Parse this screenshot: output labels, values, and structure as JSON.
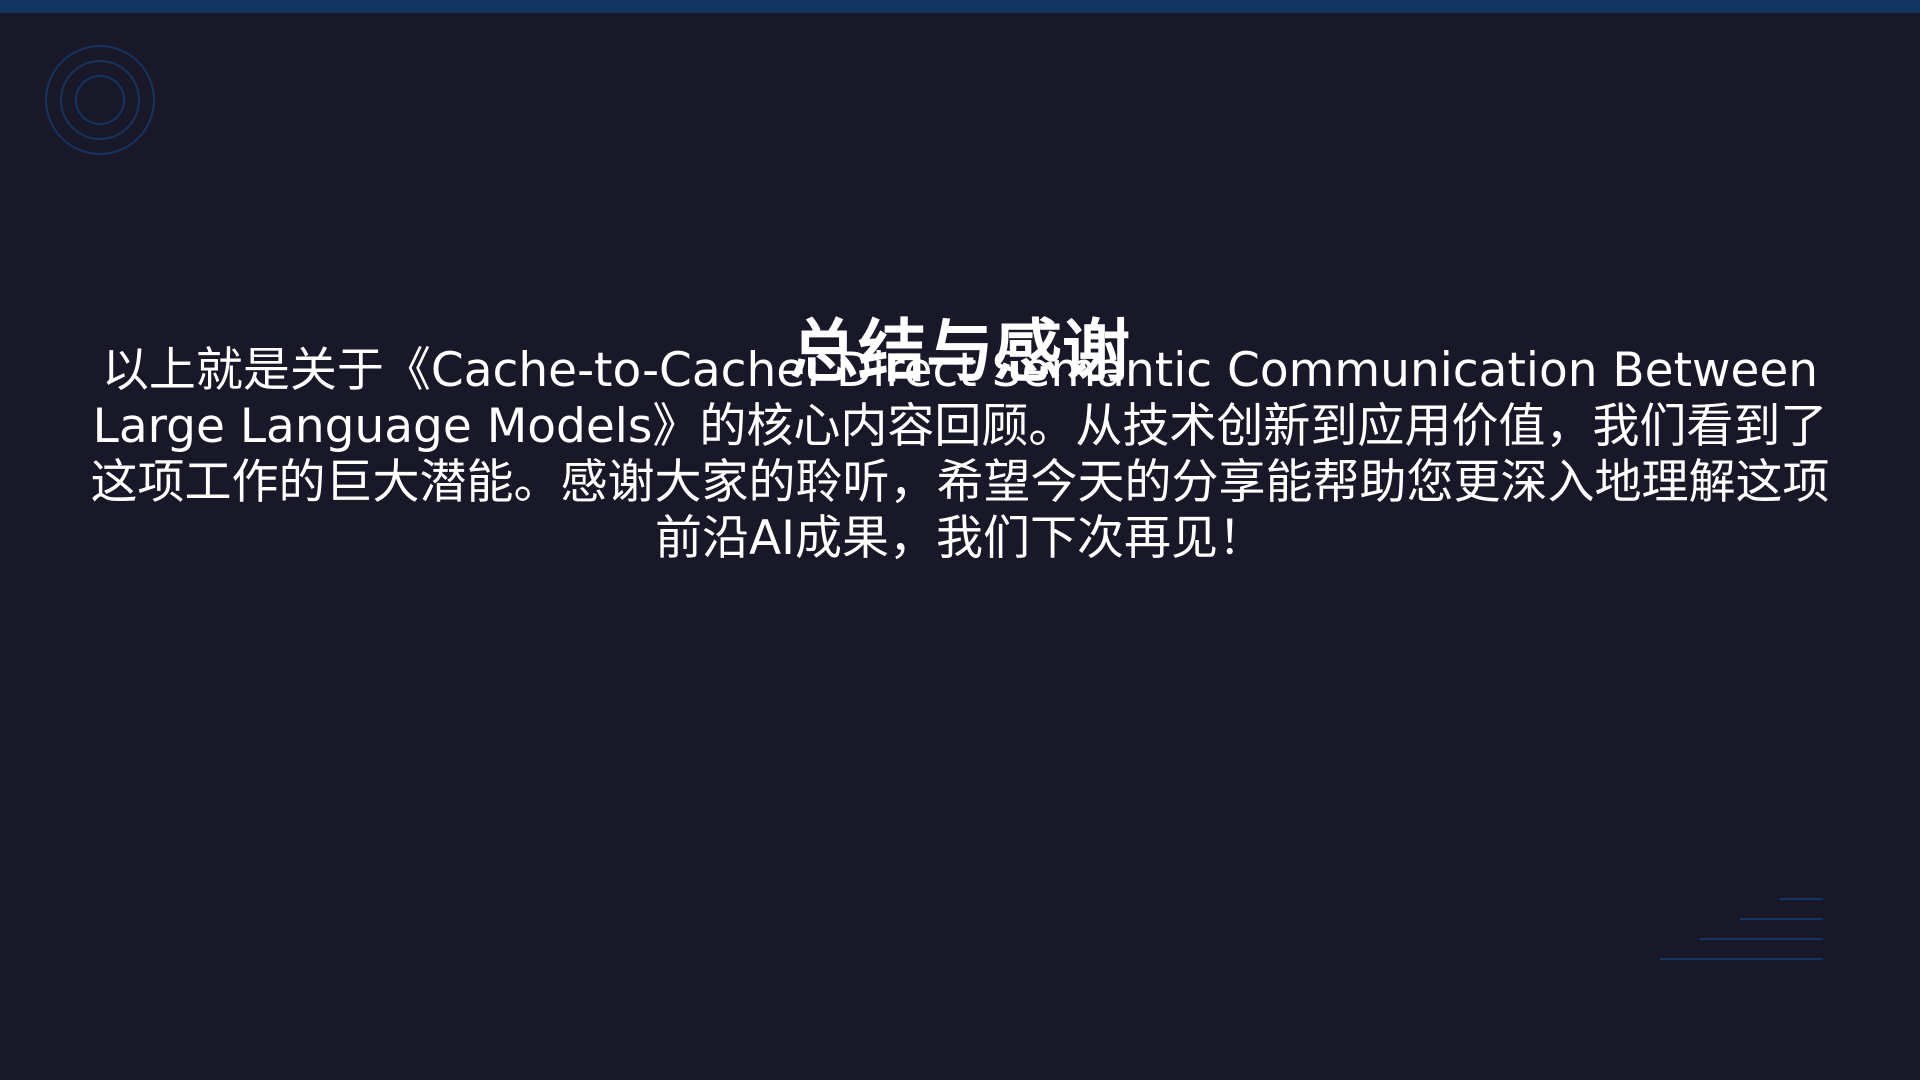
{
  "slide": {
    "title": "总结与感谢",
    "body": "以上就是关于《Cache-to-Cache: Direct Semantic Communication Between Large Language Models》的核心内容回顾。从技术创新到应用价值，我们看到了这项工作的巨大潜能。感谢大家的聆听，希望今天的分享能帮助您更深入地理解这项前沿AI成果，我们下次再见！"
  },
  "colors": {
    "background": "#181828",
    "accent": "#143463",
    "text": "#ffffff"
  },
  "decorations": {
    "top_left": "concentric-circles-icon",
    "bottom_right": "stacked-lines-icon"
  }
}
